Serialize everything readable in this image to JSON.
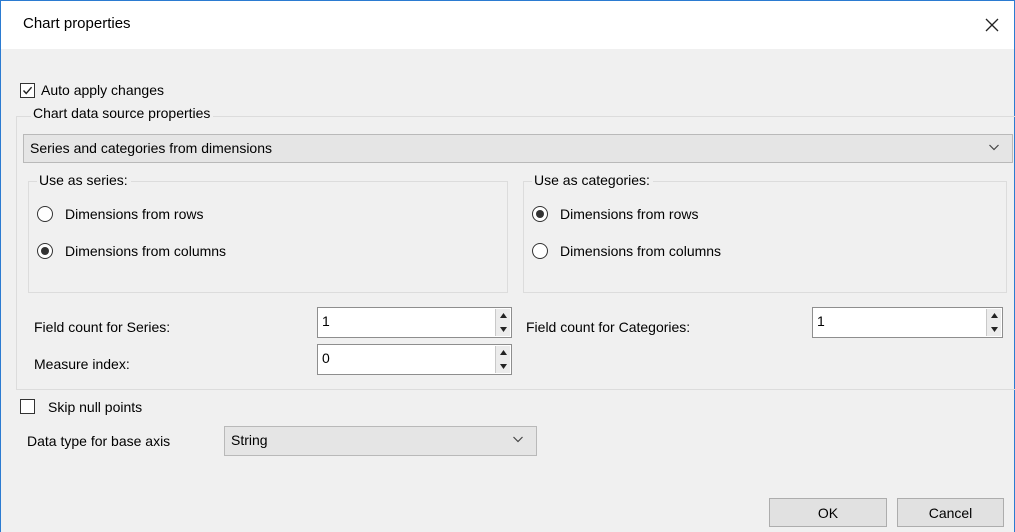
{
  "window": {
    "title": "Chart properties"
  },
  "auto_apply": {
    "label": "Auto apply changes",
    "checked": true
  },
  "data_source_group": {
    "legend": "Chart data source properties",
    "selected": "Series and categories from dimensions"
  },
  "series_group": {
    "legend": "Use as series:",
    "options": [
      {
        "label": "Dimensions from rows",
        "selected": false
      },
      {
        "label": "Dimensions from columns",
        "selected": true
      }
    ]
  },
  "categories_group": {
    "legend": "Use as categories:",
    "options": [
      {
        "label": "Dimensions from rows",
        "selected": true
      },
      {
        "label": "Dimensions from columns",
        "selected": false
      }
    ]
  },
  "field_count_series": {
    "label": "Field count for Series:",
    "value": "1"
  },
  "field_count_categories": {
    "label": "Field count for Categories:",
    "value": "1"
  },
  "measure_index": {
    "label": "Measure index:",
    "value": "0"
  },
  "skip_null": {
    "label": "Skip null points",
    "checked": false
  },
  "base_axis": {
    "label": "Data type for base axis",
    "selected": "String"
  },
  "buttons": {
    "ok": "OK",
    "cancel": "Cancel"
  },
  "icons": {
    "close": "close-icon",
    "checkmark": "checkmark-icon",
    "dropdown": "chevron-down-icon",
    "spin_up": "arrow-up-icon",
    "spin_down": "arrow-down-icon"
  }
}
